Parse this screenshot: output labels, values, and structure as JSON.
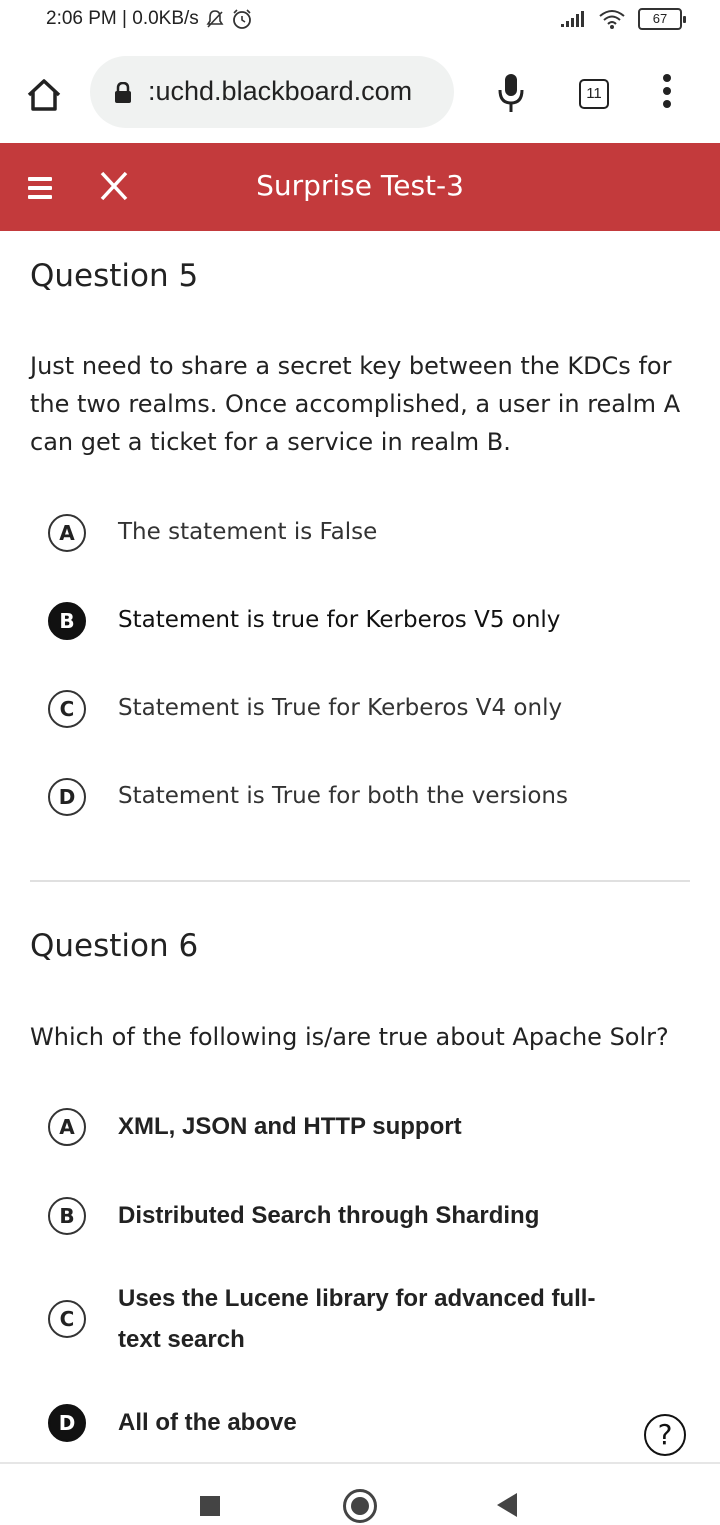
{
  "status_bar": {
    "time_speed": "2:06 PM | 0.0KB/s",
    "battery": "67"
  },
  "browser": {
    "url": ":uchd.blackboard.com",
    "tab_count": "11"
  },
  "header": {
    "title": "Surprise Test-3",
    "accent_color": "#c33a3c"
  },
  "questions": [
    {
      "heading": "Question 5",
      "text": "Just need to share a secret key between the KDCs for the two realms. Once accomplished, a user in realm A can get a ticket for a service in realm B.",
      "options": [
        {
          "letter": "A",
          "label": "The statement is False",
          "selected": false
        },
        {
          "letter": "B",
          "label": "Statement is true for Kerberos V5 only",
          "selected": true
        },
        {
          "letter": "C",
          "label": "Statement is True for Kerberos V4 only",
          "selected": false
        },
        {
          "letter": "D",
          "label": "Statement is True for both the versions",
          "selected": false
        }
      ]
    },
    {
      "heading": "Question 6",
      "text": "Which of the following is/are true about Apache Solr?",
      "options": [
        {
          "letter": "A",
          "label": "XML, JSON and HTTP support",
          "selected": false
        },
        {
          "letter": "B",
          "label": "Distributed Search through Sharding",
          "selected": false
        },
        {
          "letter": "C",
          "label": "Uses the Lucene library for advanced full-text search",
          "selected": false
        },
        {
          "letter": "D",
          "label": "All of the above",
          "selected": true
        }
      ]
    }
  ],
  "help_icon": "?"
}
